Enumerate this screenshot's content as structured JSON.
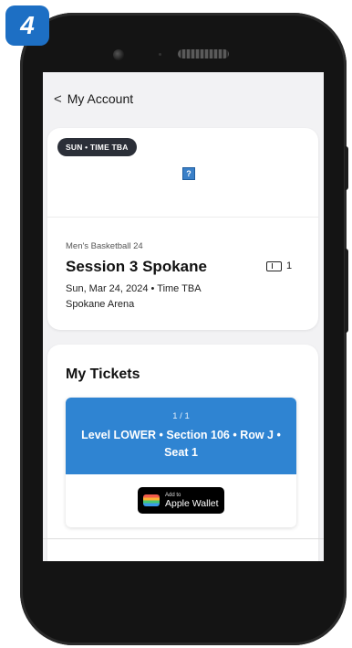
{
  "step_badge": "4",
  "header": {
    "back_label": "My Account"
  },
  "event": {
    "date_badge": "SUN • TIME TBA",
    "image_placeholder": "?",
    "sport": "Men's Basketball 24",
    "title": "Session 3 Spokane",
    "date_line": "Sun, Mar 24, 2024 • Time TBA",
    "venue": "Spokane Arena",
    "ticket_count": "1",
    "ticket_icon": "ticket-icon"
  },
  "tickets": {
    "heading": "My Tickets",
    "items": [
      {
        "index": "1 / 1",
        "seat": "Level LOWER • Section 106 • Row J • Seat 1",
        "wallet_small": "Add to",
        "wallet_big": "Apple Wallet"
      }
    ]
  },
  "colors": {
    "badge": "#1d6fc4",
    "ticket_header": "#2f84d2",
    "date_pill": "#2b2f38"
  }
}
